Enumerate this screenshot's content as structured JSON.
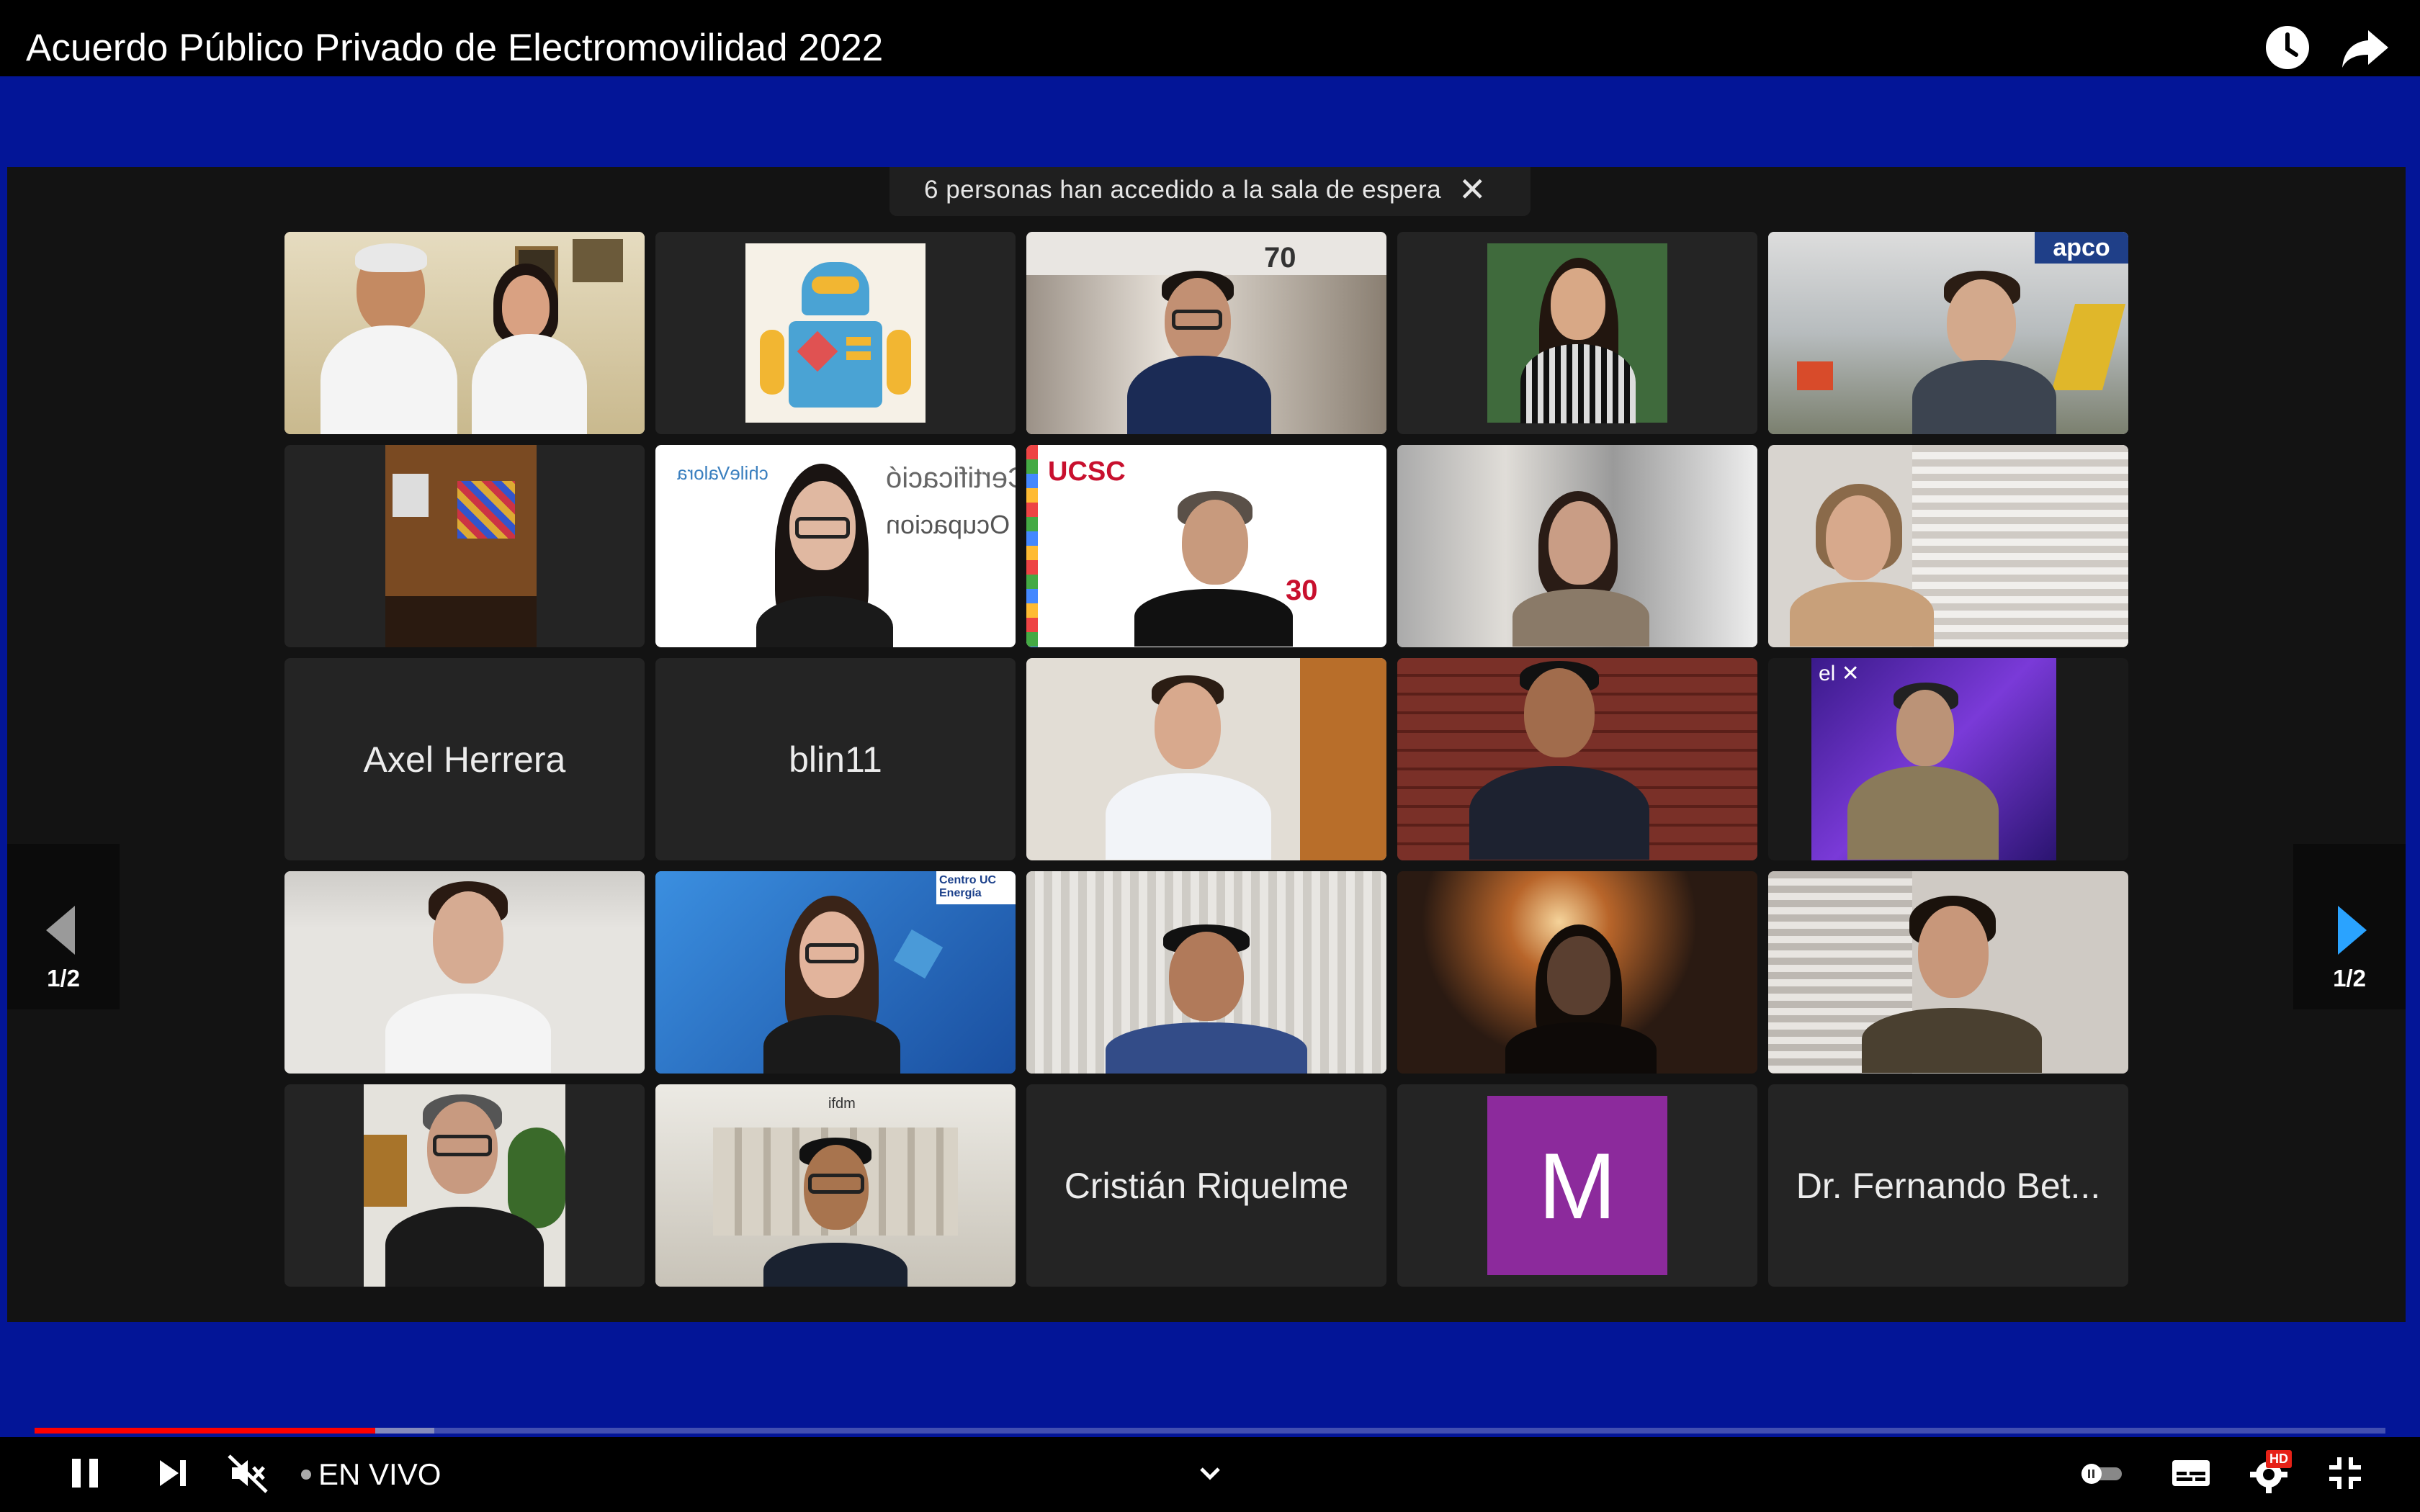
{
  "header": {
    "title": "Acuerdo Público Privado de Electromovilidad 2022",
    "watch_later_icon": "clock-icon",
    "share_icon": "share-arrow-icon"
  },
  "meeting": {
    "waiting_room_notice": "6 personas han accedido a la sala de espera",
    "close_symbol": "✕",
    "page_indicator": "1/2",
    "participants_name_only": {
      "axel": "Axel Herrera",
      "blin": "blin11",
      "cristian": "Cristián Riquelme",
      "m_initial": "M",
      "fernando": "Dr. Fernando Bet..."
    },
    "logos": {
      "ucsc": "UCSC",
      "ucsc_years": "30",
      "chilevalora": "chileValora",
      "centro_uc": "Centro UC Energía",
      "apco": "apco",
      "seventy": "70",
      "cert_text": "Certificació",
      "cert_ocup": "Ocupacion"
    }
  },
  "player": {
    "live_label": "EN VIVO",
    "progress_played_fraction": 0.145,
    "progress_buffered_fraction": 0.17,
    "hd_badge": "HD"
  },
  "colors": {
    "frame_blue": "#031597",
    "progress_red": "#ff0000",
    "grid_background": "#131313"
  }
}
